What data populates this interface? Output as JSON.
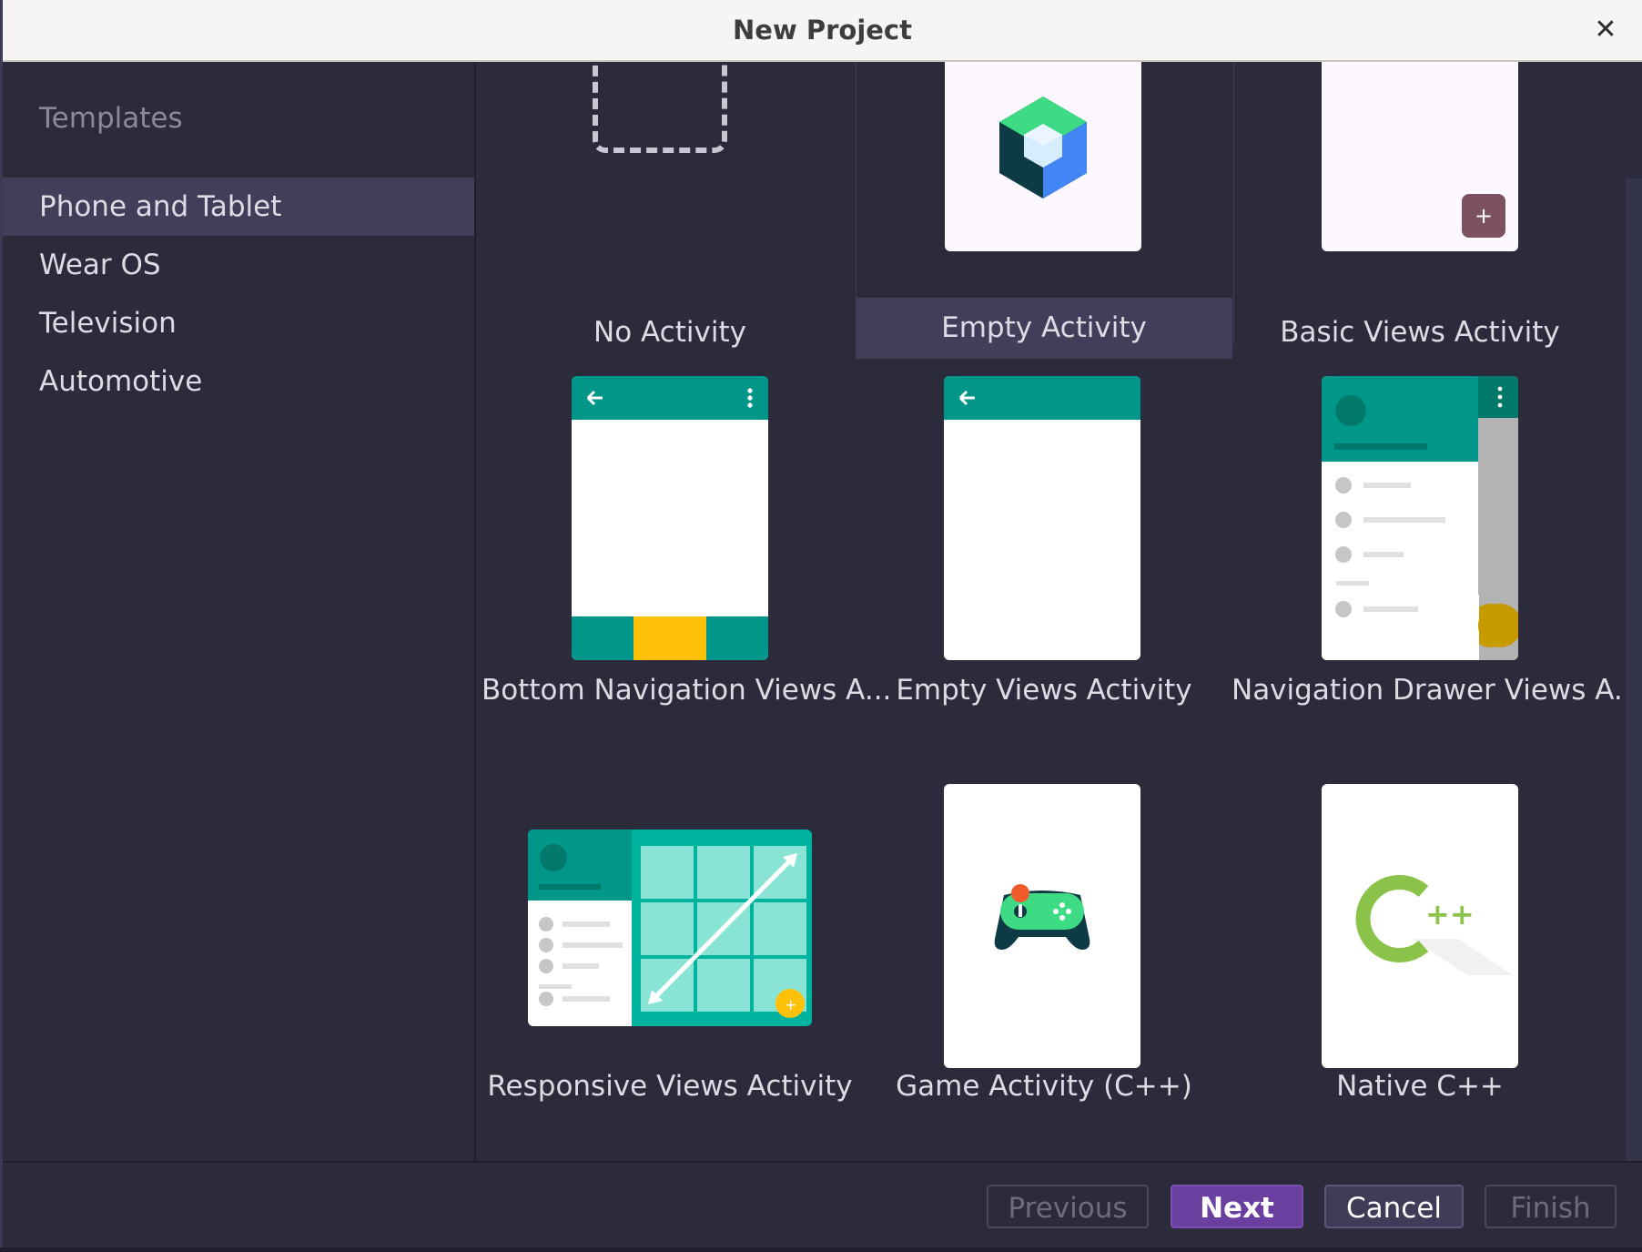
{
  "window": {
    "title": "New Project",
    "close_icon": "✕"
  },
  "sidebar": {
    "header": "Templates",
    "items": [
      {
        "label": "Phone and Tablet",
        "selected": true
      },
      {
        "label": "Wear OS",
        "selected": false
      },
      {
        "label": "Television",
        "selected": false
      },
      {
        "label": "Automotive",
        "selected": false
      }
    ]
  },
  "templates": [
    {
      "label": "No Activity",
      "icon": "dashed-placeholder-icon"
    },
    {
      "label": "Empty Activity",
      "icon": "jetpack-compose-icon",
      "selected": true
    },
    {
      "label": "Basic Views Activity",
      "icon": "basic-views-thumbnail"
    },
    {
      "label": "Bottom Navigation Views A...",
      "icon": "bottom-navigation-thumbnail"
    },
    {
      "label": "Empty Views Activity",
      "icon": "empty-views-thumbnail"
    },
    {
      "label": "Navigation Drawer Views A...",
      "icon": "navigation-drawer-thumbnail"
    },
    {
      "label": "Responsive Views Activity",
      "icon": "responsive-views-thumbnail"
    },
    {
      "label": "Game Activity (C++)",
      "icon": "gamepad-icon"
    },
    {
      "label": "Native C++",
      "icon": "cpp-logo-icon"
    }
  ],
  "fab_plus": "+",
  "cpp_logo_text": "++",
  "footer": {
    "previous": "Previous",
    "next": "Next",
    "cancel": "Cancel",
    "finish": "Finish"
  },
  "colors": {
    "accent": "#6b3fa0",
    "selection": "#413e5a",
    "teal": "#00968a",
    "amber": "#ffc107"
  }
}
